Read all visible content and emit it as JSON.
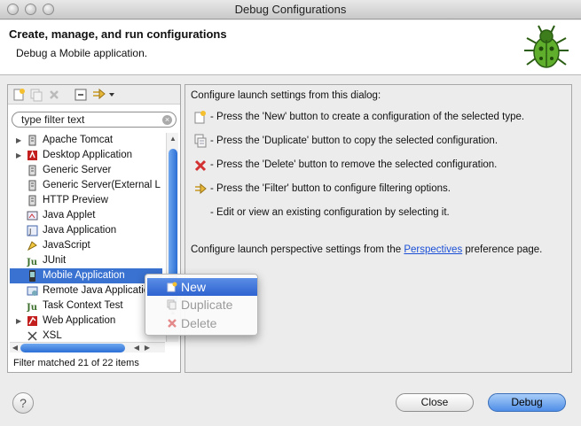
{
  "window": {
    "title": "Debug Configurations"
  },
  "banner": {
    "title": "Create, manage, and run configurations",
    "subtitle": "Debug a Mobile application."
  },
  "filter": {
    "placeholder": "type filter text"
  },
  "tree": {
    "items": [
      {
        "label": "Apache Tomcat",
        "expandable": true,
        "icon": "server-icon"
      },
      {
        "label": "Desktop Application",
        "expandable": true,
        "icon": "desktop-app-icon"
      },
      {
        "label": "Generic Server",
        "expandable": false,
        "icon": "server-icon"
      },
      {
        "label": "Generic Server(External L",
        "expandable": false,
        "icon": "server-icon"
      },
      {
        "label": "HTTP Preview",
        "expandable": false,
        "icon": "server-icon"
      },
      {
        "label": "Java Applet",
        "expandable": false,
        "icon": "applet-icon"
      },
      {
        "label": "Java Application",
        "expandable": false,
        "icon": "java-app-icon"
      },
      {
        "label": "JavaScript",
        "expandable": false,
        "icon": "javascript-icon"
      },
      {
        "label": "JUnit",
        "expandable": false,
        "icon": "junit-icon"
      },
      {
        "label": "Mobile Application",
        "expandable": false,
        "icon": "mobile-icon",
        "selected": true
      },
      {
        "label": "Remote Java Applicatio",
        "expandable": false,
        "icon": "remote-java-icon"
      },
      {
        "label": "Task Context Test",
        "expandable": false,
        "icon": "junit-icon"
      },
      {
        "label": "Web Application",
        "expandable": true,
        "icon": "web-app-icon"
      },
      {
        "label": "XSL",
        "expandable": false,
        "icon": "xsl-icon"
      }
    ]
  },
  "status": {
    "text": "Filter matched 21 of 22 items"
  },
  "right": {
    "intro": "Configure launch settings from this dialog:",
    "items": [
      {
        "text": "- Press the 'New' button to create a configuration of the selected type.",
        "icon": "new-config-icon"
      },
      {
        "text": "- Press the 'Duplicate' button to copy the selected configuration.",
        "icon": "duplicate-icon"
      },
      {
        "text": "- Press the 'Delete' button to remove the selected configuration.",
        "icon": "delete-icon"
      },
      {
        "text": "- Press the 'Filter' button to configure filtering options.",
        "icon": "filter-icon"
      },
      {
        "text": "- Edit or view an existing configuration by selecting it.",
        "icon": ""
      }
    ],
    "perspective_prefix": "Configure launch perspective settings from the ",
    "perspective_link": "Perspectives",
    "perspective_suffix": " preference page."
  },
  "context_menu": {
    "items": [
      {
        "label": "New",
        "enabled": true,
        "selected": true
      },
      {
        "label": "Duplicate",
        "enabled": false
      },
      {
        "label": "Delete",
        "enabled": false
      }
    ]
  },
  "buttons": {
    "help": "?",
    "close": "Close",
    "debug": "Debug"
  },
  "colors": {
    "selection": "#3a72d1",
    "link": "#1a4fd6",
    "delete_red": "#d33131"
  }
}
